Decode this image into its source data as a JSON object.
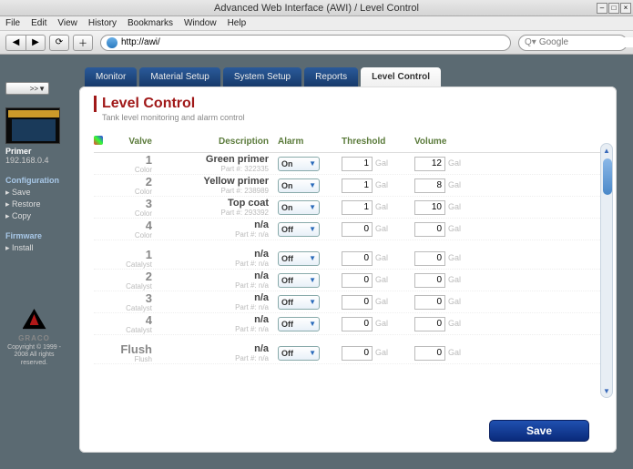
{
  "window": {
    "title": "Advanced Web Interface (AWI) / Level Control",
    "menu": [
      "File",
      "Edit",
      "View",
      "History",
      "Bookmarks",
      "Window",
      "Help"
    ],
    "url": "http://awi/",
    "search_placeholder": "Google",
    "search_prefix": "Q▾"
  },
  "sidebar": {
    "dropdown": ">>",
    "device_name": "Primer",
    "device_ip": "192.168.0.4",
    "sections": [
      {
        "title": "Configuration",
        "items": [
          "Save",
          "Restore",
          "Copy"
        ]
      },
      {
        "title": "Firmware",
        "items": [
          "Install"
        ]
      }
    ],
    "logo_text": "GRACO",
    "copyright": "Copyright © 1999 - 2008\nAll rights reserved."
  },
  "tabs": [
    "Monitor",
    "Material Setup",
    "System Setup",
    "Reports",
    "Level Control"
  ],
  "active_tab": 4,
  "page": {
    "title": "Level Control",
    "subtitle": "Tank level monitoring and alarm control",
    "columns": {
      "valve": "Valve",
      "desc": "Description",
      "alarm": "Alarm",
      "thresh": "Threshold",
      "vol": "Volume"
    },
    "unit": "Gal",
    "save_label": "Save",
    "groups": [
      {
        "rows": [
          {
            "valve": "1",
            "valve_label": "Color",
            "desc": "Green primer",
            "sub": "Part #: 322335",
            "alarm": "On",
            "threshold": "1",
            "volume": "12"
          },
          {
            "valve": "2",
            "valve_label": "Color",
            "desc": "Yellow primer",
            "sub": "Part #: 238989",
            "alarm": "On",
            "threshold": "1",
            "volume": "8"
          },
          {
            "valve": "3",
            "valve_label": "Color",
            "desc": "Top coat",
            "sub": "Part #: 293392",
            "alarm": "On",
            "threshold": "1",
            "volume": "10"
          },
          {
            "valve": "4",
            "valve_label": "Color",
            "desc": "n/a",
            "sub": "Part #: n/a",
            "alarm": "Off",
            "threshold": "0",
            "volume": "0"
          }
        ]
      },
      {
        "rows": [
          {
            "valve": "1",
            "valve_label": "Catalyst",
            "desc": "n/a",
            "sub": "Part #: n/a",
            "alarm": "Off",
            "threshold": "0",
            "volume": "0"
          },
          {
            "valve": "2",
            "valve_label": "Catalyst",
            "desc": "n/a",
            "sub": "Part #: n/a",
            "alarm": "Off",
            "threshold": "0",
            "volume": "0"
          },
          {
            "valve": "3",
            "valve_label": "Catalyst",
            "desc": "n/a",
            "sub": "Part #: n/a",
            "alarm": "Off",
            "threshold": "0",
            "volume": "0"
          },
          {
            "valve": "4",
            "valve_label": "Catalyst",
            "desc": "n/a",
            "sub": "Part #: n/a",
            "alarm": "Off",
            "threshold": "0",
            "volume": "0"
          }
        ]
      },
      {
        "rows": [
          {
            "valve": "Flush",
            "valve_label": "Flush",
            "desc": "n/a",
            "sub": "Part #: n/a",
            "alarm": "Off",
            "threshold": "0",
            "volume": "0"
          }
        ]
      }
    ]
  }
}
